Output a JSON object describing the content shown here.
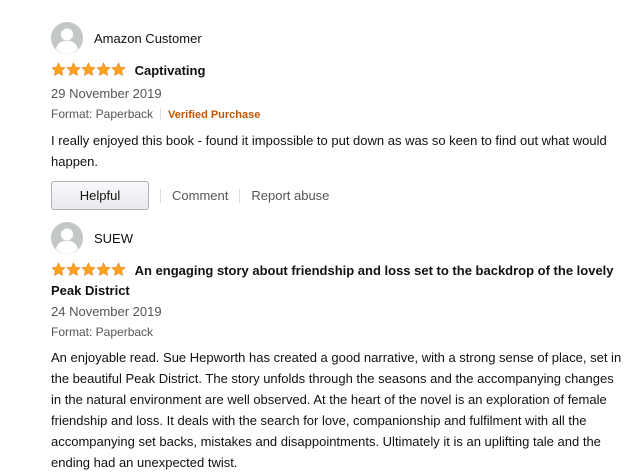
{
  "reviews": [
    {
      "profile_name": "Amazon Customer",
      "rating": 5,
      "title": "Captivating",
      "date": "29 November 2019",
      "format": "Format: Paperback",
      "verified": "Verified Purchase",
      "body": "I really enjoyed this book - found it impossible to put down as was so keen to find out what would happen.",
      "helpful_label": "Helpful",
      "comment_label": "Comment",
      "report_label": "Report abuse"
    },
    {
      "profile_name": "SUEW",
      "rating": 5,
      "title": "An engaging story about friendship and loss set to the backdrop of the lovely Peak District",
      "date": "24 November 2019",
      "format": "Format: Paperback",
      "body": "An enjoyable read. Sue Hepworth has created a good narrative, with a strong sense of place, set in the beautiful Peak District. The story unfolds through the seasons and the accompanying changes in the natural environment are well observed. At the heart of the novel is an exploration of female friendship and loss. It deals with the search for love, companionship and fulfilment with all the accompanying set backs, mistakes and disappointments. Ultimately it is an uplifting tale and the ending had an unexpected twist."
    }
  ],
  "colors": {
    "star": "#ffa41c",
    "verified": "#c45500",
    "avatar_bg": "#c4c7c8"
  },
  "icons": {
    "avatar": "user-silhouette-icon",
    "star": "star-icon"
  }
}
